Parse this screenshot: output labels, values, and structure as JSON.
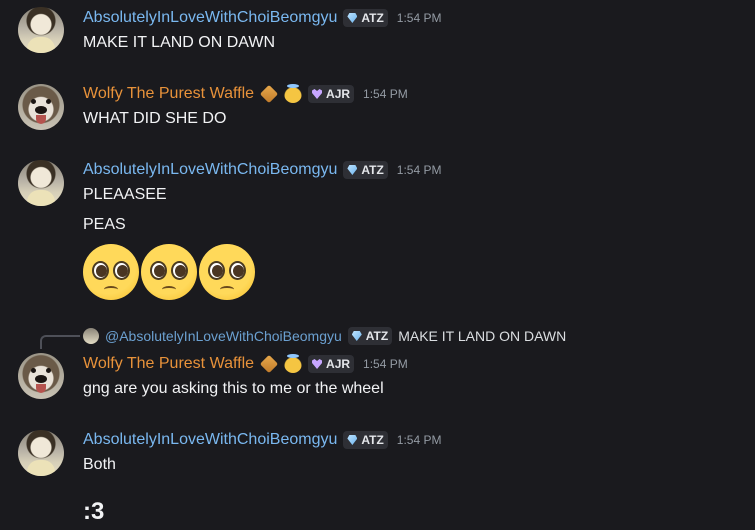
{
  "messages": [
    {
      "username": "AbsolutelyInLoveWithChoiBeomgyu",
      "tag": "ATZ",
      "time": "1:54 PM",
      "lines": [
        "MAKE IT LAND ON DAWN"
      ]
    },
    {
      "username": "Wolfy The Purest Waffle",
      "tag": "AJR",
      "time": "1:54 PM",
      "lines": [
        "WHAT DID SHE DO"
      ]
    },
    {
      "username": "AbsolutelyInLoveWithChoiBeomgyu",
      "tag": "ATZ",
      "time": "1:54 PM",
      "lines": [
        "PLEAASEE",
        "PEAS"
      ],
      "emojis": [
        "pleading-face",
        "pleading-face",
        "pleading-face"
      ]
    },
    {
      "reply": {
        "username": "@AbsolutelyInLoveWithChoiBeomgyu",
        "tag": "ATZ",
        "text": "MAKE IT LAND ON DAWN"
      },
      "username": "Wolfy The Purest Waffle",
      "tag": "AJR",
      "time": "1:54 PM",
      "lines": [
        "gng are you asking this to me or the wheel"
      ]
    },
    {
      "username": "AbsolutelyInLoveWithChoiBeomgyu",
      "tag": "ATZ",
      "time": "1:54 PM",
      "lines": [
        "Both",
        ":3"
      ]
    }
  ],
  "colors": {
    "background": "#1a1a1e",
    "username_blue": "#7ab8f0",
    "username_orange": "#e8923a",
    "timestamp": "#949ba4"
  },
  "icons": {
    "atz_tag_icon": "gem-icon",
    "ajr_tag_icon": "heart-icon",
    "waffle_role_icon": "waffle-icon",
    "angel_role_icon": "angel-face-icon"
  }
}
